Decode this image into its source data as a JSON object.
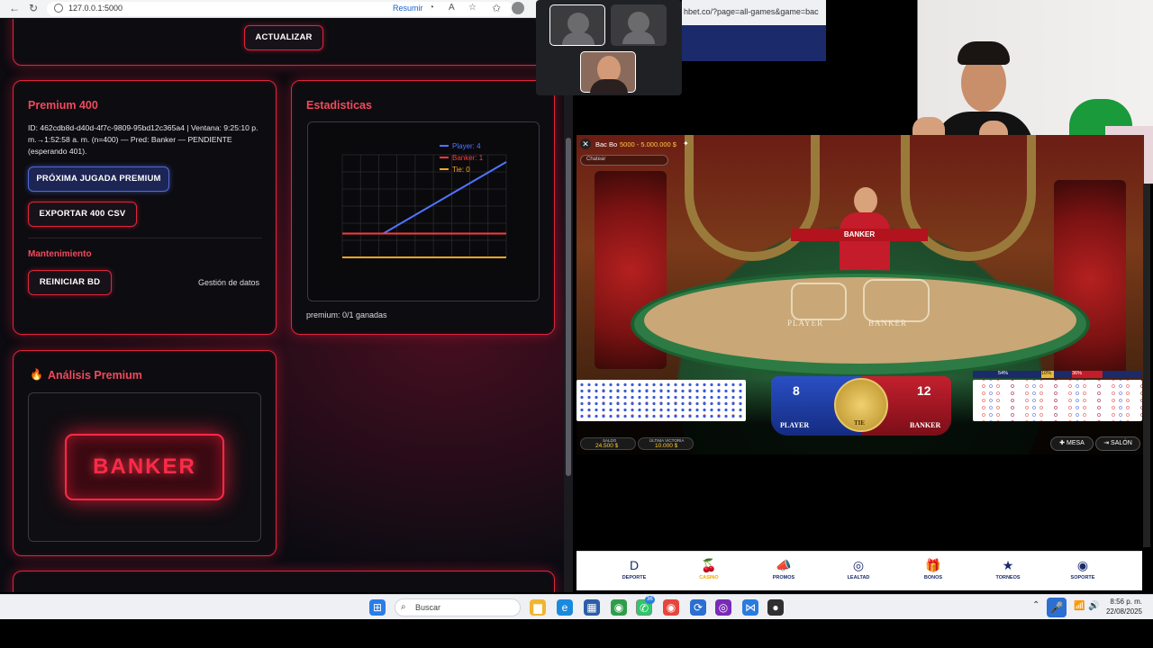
{
  "browser": {
    "url": "127.0.0.1:5000",
    "resume_label": "Resumir",
    "game_url_fragment": "hbet.co/?page=all-games&game=bac"
  },
  "top_card": {
    "update_button": "ACTUALIZAR"
  },
  "premium_card": {
    "title": "Premium 400",
    "info": "ID: 462cdb8d-d40d-4f7c-9809-95bd12c365a4 | Ventana: 9:25:10 p. m.→1:52:58 a. m. (n=400) — Pred: Banker — PENDIENTE (esperando 401).",
    "next_button": "PRÓXIMA JUGADA PREMIUM",
    "export_button": "EXPORTAR 400 CSV",
    "maintenance_title": "Mantenimiento",
    "reset_button": "REINICIAR BD",
    "data_mgmt": "Gestión de datos"
  },
  "stats_card": {
    "title": "Estadisticas",
    "footer": "premium: 0/1 ganadas"
  },
  "analysis_card": {
    "title": "Análisis Premium",
    "prediction": "BANKER",
    "icon": "fire-icon"
  },
  "chart_data": {
    "type": "line",
    "legend_placement": "top-right",
    "grid": true,
    "x": [
      0,
      1,
      2,
      3,
      4,
      5,
      6,
      7,
      8
    ],
    "series": [
      {
        "name": "Player: 4",
        "color": "#4f74ff",
        "values": [
          1,
          1,
          1,
          1.5,
          2,
          2.5,
          3,
          3.5,
          4
        ]
      },
      {
        "name": "Banker: 1",
        "color": "#ff3a3a",
        "values": [
          1,
          1,
          1,
          1,
          1,
          1,
          1,
          1,
          1
        ]
      },
      {
        "name": "Tie: 0",
        "color": "#f5a623",
        "values": [
          0,
          0,
          0,
          0,
          0,
          0,
          0,
          0,
          0
        ]
      }
    ],
    "ylim": [
      0,
      4.3
    ]
  },
  "game": {
    "title": "Bac Bo",
    "limits": "5000 - 5.000.000 $",
    "chat_placeholder": "Chatear",
    "banker_sign": "BANKER",
    "player_label": "PLAYER",
    "banker_label": "BANKER",
    "tie_label": "TIE",
    "player_score": "8",
    "banker_score": "12",
    "stats_pcts": [
      "54%",
      "10%",
      "36%"
    ],
    "balance_label": "SALDO",
    "balance_value": "24.500 $",
    "last_win_label": "ÚLTIMA VICTORIA",
    "last_win_value": "10.000 $",
    "table_button": "MESA",
    "lobby_button": "SALÓN"
  },
  "bottom_nav": [
    {
      "label": "DEPORTE",
      "icon": "D"
    },
    {
      "label": "CASINO",
      "icon": "🍒"
    },
    {
      "label": "PROMOS",
      "icon": "📣"
    },
    {
      "label": "LEALTAD",
      "icon": "◎"
    },
    {
      "label": "BONOS",
      "icon": "🎁"
    },
    {
      "label": "TORNEOS",
      "icon": "★"
    },
    {
      "label": "SOPORTE",
      "icon": "◉"
    }
  ],
  "taskbar": {
    "search_placeholder": "Buscar",
    "time": "8:56 p. m.",
    "date": "22/08/2025",
    "whatsapp_badge": "36"
  }
}
